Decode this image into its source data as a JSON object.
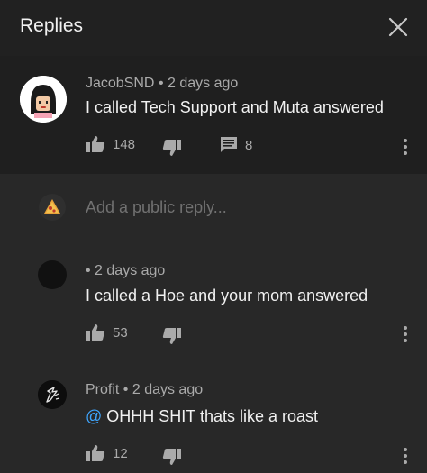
{
  "header": {
    "title": "Replies"
  },
  "top_comment": {
    "author": "JacobSND",
    "time": "2 days ago",
    "text": "I called Tech Support and Muta answered",
    "likes": "148",
    "replies": "8"
  },
  "reply_box": {
    "placeholder": "Add a public reply..."
  },
  "replies": [
    {
      "author": "",
      "time": "2 days ago",
      "text": "I called a Hoe and your mom answered",
      "likes": "53"
    },
    {
      "author": "Profit",
      "time": "2 days ago",
      "mention": "@",
      "text": "OHHH SHIT thats like a roast",
      "likes": "12"
    }
  ],
  "colors": {
    "background": "#282828",
    "header": "#212121",
    "highlight": "#1f1f1f",
    "mention": "#3ea6ff",
    "muted": "#aaaaaa"
  },
  "icons": [
    "close-icon",
    "thumbs-up-icon",
    "thumbs-down-icon",
    "comment-icon",
    "more-vert-icon"
  ]
}
